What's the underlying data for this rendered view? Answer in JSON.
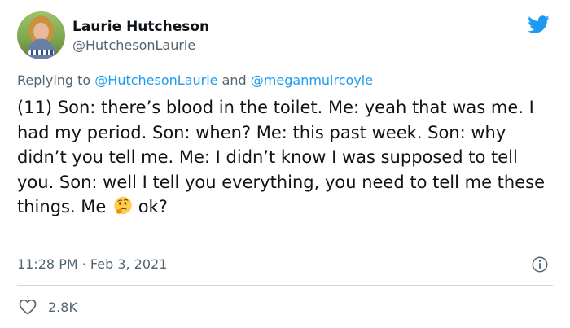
{
  "author": {
    "name": "Laurie Hutcheson",
    "handle": "@HutchesonLaurie"
  },
  "reply": {
    "prefix": "Replying to ",
    "mention1": "@HutchesonLaurie",
    "conj": " and ",
    "mention2": "@meganmuircoyle"
  },
  "tweet": {
    "text": "(11) Son: there’s blood in the toilet.  Me: yeah that was me. I had my period. Son: when?  Me: this past week. Son: why didn’t you tell me. Me: I didn’t know I was supposed to tell you. Son: well I tell you everything, you need to tell me these things. Me ",
    "text_end": " ok?",
    "emoji": "thinking-face-icon"
  },
  "meta": {
    "timestamp": "11:28 PM · Feb 3, 2021"
  },
  "stats": {
    "likes": "2.8K"
  },
  "colors": {
    "brand": "#1d9bf0",
    "text": "#0f1419",
    "secondary": "#536471",
    "divider": "#cfd9de"
  },
  "icons": {
    "logo": "twitter-bird-icon",
    "info": "info-icon",
    "like": "heart-icon"
  }
}
